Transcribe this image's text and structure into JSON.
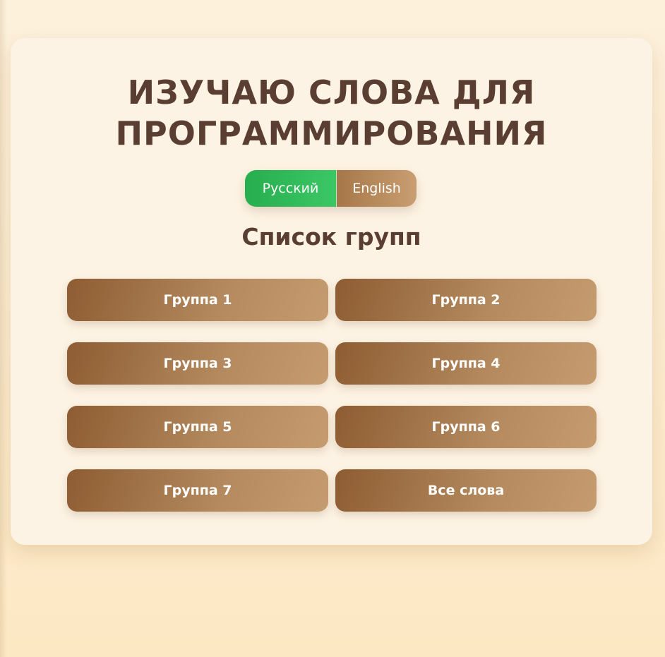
{
  "header": {
    "title": "ИЗУЧАЮ СЛОВА ДЛЯ ПРОГРАММИРОВАНИЯ"
  },
  "language_toggle": {
    "active": "Русский",
    "options": [
      {
        "label": "Русский",
        "selected": true
      },
      {
        "label": "English",
        "selected": false
      }
    ]
  },
  "groups_section": {
    "title": "Список групп",
    "groups": [
      {
        "label": "Группа 1"
      },
      {
        "label": "Группа 2"
      },
      {
        "label": "Группа 3"
      },
      {
        "label": "Группа 4"
      },
      {
        "label": "Группа 5"
      },
      {
        "label": "Группа 6"
      },
      {
        "label": "Группа 7"
      },
      {
        "label": "Все слова"
      }
    ]
  },
  "colors": {
    "page_background": "#fdecc9",
    "card_background": "#fdf3e4",
    "title_text": "#5a3e32",
    "active_language": "#2eb857",
    "button_brown": "#a06c40"
  }
}
